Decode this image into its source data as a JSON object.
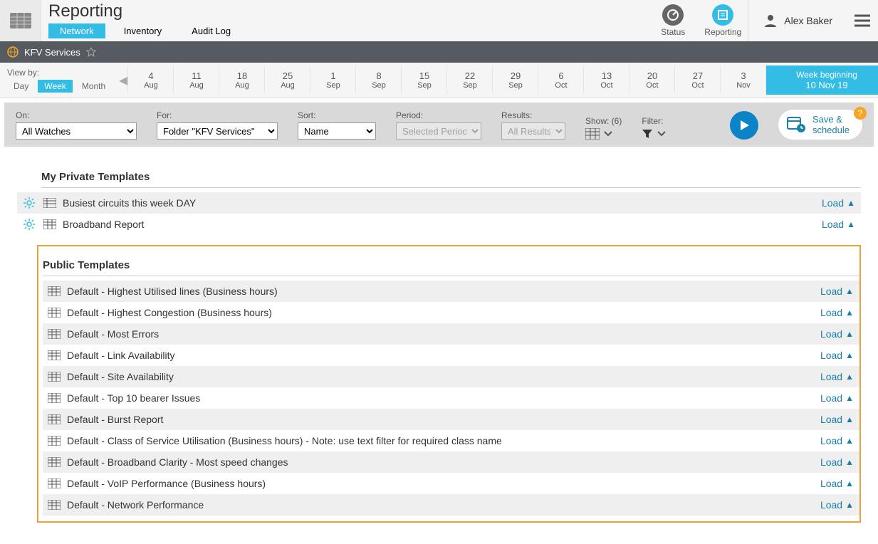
{
  "header": {
    "title": "Reporting",
    "tabs": [
      {
        "label": "Network",
        "active": true
      },
      {
        "label": "Inventory",
        "active": false
      },
      {
        "label": "Audit Log",
        "active": false
      }
    ],
    "status_label": "Status",
    "reporting_label": "Reporting",
    "user_name": "Alex Baker"
  },
  "breadcrumb": {
    "folder": "KFV Services"
  },
  "viewby": {
    "label": "View by:",
    "options": [
      {
        "label": "Day",
        "active": false
      },
      {
        "label": "Week",
        "active": true
      },
      {
        "label": "Month",
        "active": false
      }
    ]
  },
  "dates": [
    {
      "day": "4",
      "mon": "Aug"
    },
    {
      "day": "11",
      "mon": "Aug"
    },
    {
      "day": "18",
      "mon": "Aug"
    },
    {
      "day": "25",
      "mon": "Aug"
    },
    {
      "day": "1",
      "mon": "Sep"
    },
    {
      "day": "8",
      "mon": "Sep"
    },
    {
      "day": "15",
      "mon": "Sep"
    },
    {
      "day": "22",
      "mon": "Sep"
    },
    {
      "day": "29",
      "mon": "Sep"
    },
    {
      "day": "6",
      "mon": "Oct"
    },
    {
      "day": "13",
      "mon": "Oct"
    },
    {
      "day": "20",
      "mon": "Oct"
    },
    {
      "day": "27",
      "mon": "Oct"
    },
    {
      "day": "3",
      "mon": "Nov"
    }
  ],
  "current_period": {
    "line1": "Week beginning",
    "line2": "10 Nov 19"
  },
  "filters": {
    "on_label": "On:",
    "on_value": "All Watches",
    "for_label": "For:",
    "for_value": "Folder \"KFV Services\"",
    "sort_label": "Sort:",
    "sort_value": "Name",
    "period_label": "Period:",
    "period_value": "Selected Period",
    "results_label": "Results:",
    "results_value": "All Results",
    "show_label": "Show: (6)",
    "filter_label": "Filter:",
    "save_schedule_line1": "Save &",
    "save_schedule_line2": "schedule"
  },
  "private_section_title": "My Private Templates",
  "public_section_title": "Public Templates",
  "load_label": "Load",
  "private_templates": [
    {
      "name": "Busiest circuits this week DAY",
      "icon": "list"
    },
    {
      "name": "Broadband Report",
      "icon": "grid"
    }
  ],
  "public_templates": [
    {
      "name": "Default - Highest Utilised lines (Business hours)"
    },
    {
      "name": "Default - Highest Congestion (Business hours)"
    },
    {
      "name": "Default - Most Errors"
    },
    {
      "name": "Default - Link Availability"
    },
    {
      "name": "Default - Site Availability"
    },
    {
      "name": "Default - Top 10 bearer Issues"
    },
    {
      "name": "Default - Burst Report"
    },
    {
      "name": "Default - Class of Service Utilisation (Business hours) - Note: use text filter for required class name"
    },
    {
      "name": "Default - Broadband Clarity - Most speed changes"
    },
    {
      "name": "Default - VoIP Performance (Business hours)"
    },
    {
      "name": "Default - Network Performance"
    }
  ]
}
